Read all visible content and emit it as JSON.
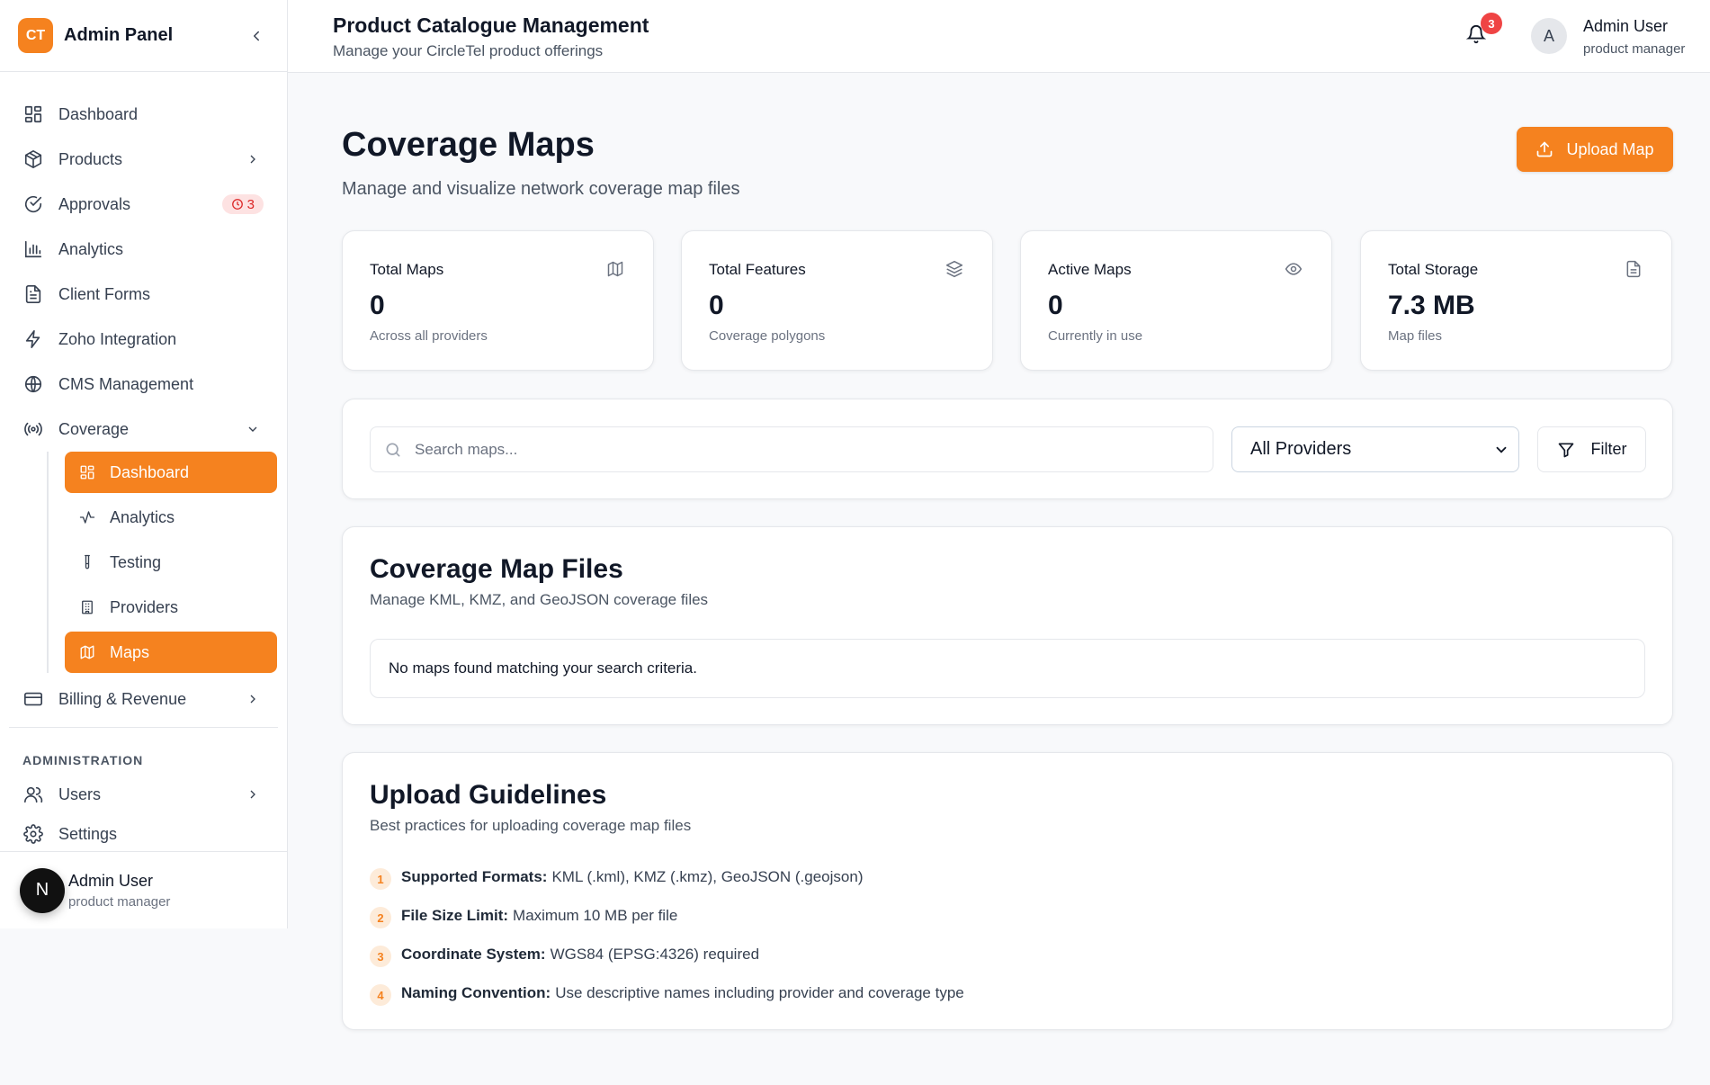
{
  "sidebar": {
    "logo_text": "CT",
    "title": "Admin Panel",
    "nav": [
      {
        "label": "Dashboard"
      },
      {
        "label": "Products"
      },
      {
        "label": "Approvals",
        "badge": "3"
      },
      {
        "label": "Analytics"
      },
      {
        "label": "Client Forms"
      },
      {
        "label": "Zoho Integration"
      },
      {
        "label": "CMS Management"
      },
      {
        "label": "Coverage"
      }
    ],
    "coverage_sub": [
      {
        "label": "Dashboard"
      },
      {
        "label": "Analytics"
      },
      {
        "label": "Testing"
      },
      {
        "label": "Providers"
      },
      {
        "label": "Maps"
      }
    ],
    "billing_label": "Billing & Revenue",
    "admin_section": "ADMINISTRATION",
    "users_label": "Users",
    "settings_label": "Settings",
    "user": {
      "initial": "N",
      "name": "Admin User",
      "role": "product manager"
    }
  },
  "topbar": {
    "title": "Product Catalogue Management",
    "subtitle": "Manage your CircleTel product offerings",
    "notification_count": "3",
    "avatar_initial": "A",
    "user_name": "Admin User",
    "user_role": "product manager"
  },
  "page": {
    "title": "Coverage Maps",
    "subtitle": "Manage and visualize network coverage map files",
    "upload_label": "Upload Map"
  },
  "stats": [
    {
      "title": "Total Maps",
      "value": "0",
      "sub": "Across all providers",
      "icon": "map-icon"
    },
    {
      "title": "Total Features",
      "value": "0",
      "sub": "Coverage polygons",
      "icon": "layers-icon"
    },
    {
      "title": "Active Maps",
      "value": "0",
      "sub": "Currently in use",
      "icon": "eye-icon"
    },
    {
      "title": "Total Storage",
      "value": "7.3 MB",
      "sub": "Map files",
      "icon": "file-icon"
    }
  ],
  "filters": {
    "search_placeholder": "Search maps...",
    "provider_selected": "All Providers",
    "filter_label": "Filter"
  },
  "files": {
    "title": "Coverage Map Files",
    "subtitle": "Manage KML, KMZ, and GeoJSON coverage files",
    "empty_message": "No maps found matching your search criteria."
  },
  "guidelines": {
    "title": "Upload Guidelines",
    "subtitle": "Best practices for uploading coverage map files",
    "items": [
      {
        "num": "1",
        "label": "Supported Formats:",
        "text": "KML (.kml), KMZ (.kmz), GeoJSON (.geojson)"
      },
      {
        "num": "2",
        "label": "File Size Limit:",
        "text": "Maximum 10 MB per file"
      },
      {
        "num": "3",
        "label": "Coordinate System:",
        "text": "WGS84 (EPSG:4326) required"
      },
      {
        "num": "4",
        "label": "Naming Convention:",
        "text": "Use descriptive names including provider and coverage type"
      }
    ]
  },
  "colors": {
    "accent": "#f5821f",
    "danger": "#ef4444"
  }
}
